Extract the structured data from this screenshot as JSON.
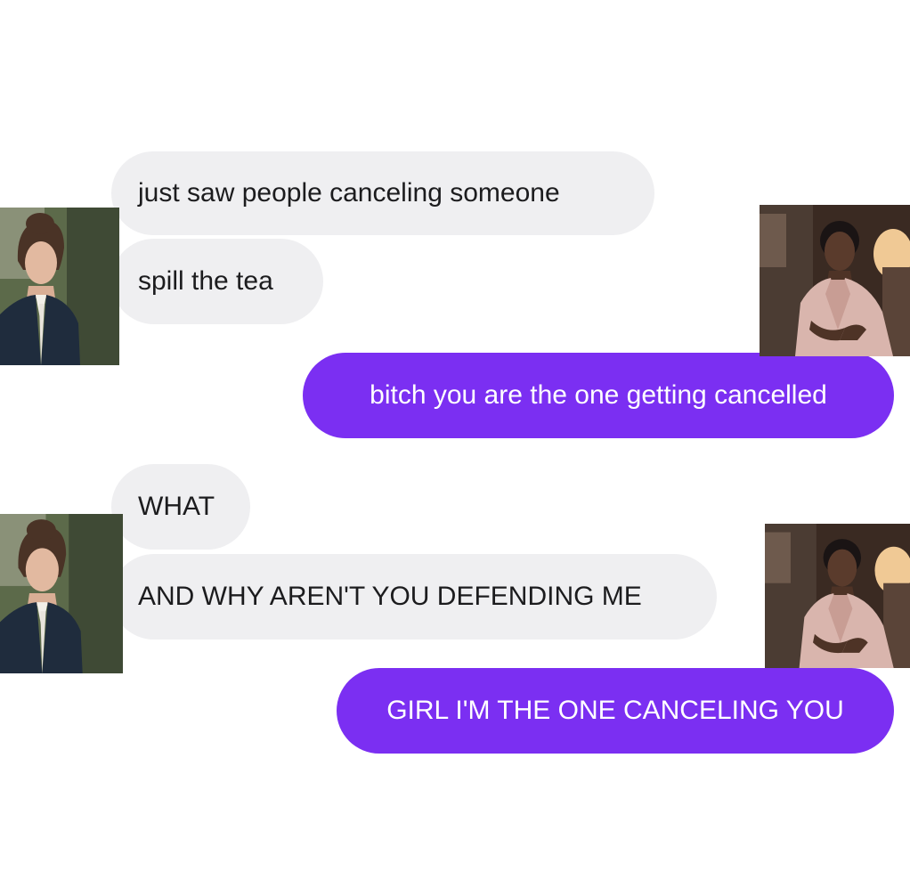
{
  "conversation": {
    "messages": [
      {
        "id": "m1",
        "side": "incoming",
        "text": "just saw people canceling someone"
      },
      {
        "id": "m2",
        "side": "incoming",
        "text": "spill the tea"
      },
      {
        "id": "m3",
        "side": "outgoing",
        "text": "bitch you are the one getting cancelled"
      },
      {
        "id": "m4",
        "side": "incoming",
        "text": "WHAT"
      },
      {
        "id": "m5",
        "side": "incoming",
        "text": "AND WHY AREN'T YOU DEFENDING ME"
      },
      {
        "id": "m6",
        "side": "outgoing",
        "text": "GIRL I'M THE ONE CANCELING YOU"
      }
    ],
    "colors": {
      "incoming_bubble": "#efeff1",
      "incoming_text": "#1c1c1e",
      "outgoing_bubble": "#7b2ff2",
      "outgoing_text": "#ffffff"
    },
    "avatars": [
      {
        "id": "a1",
        "side": "left",
        "icon": "woman-in-navy-blazer-portrait"
      },
      {
        "id": "a2",
        "side": "right",
        "icon": "woman-in-pink-coat-portrait"
      },
      {
        "id": "a3",
        "side": "left",
        "icon": "woman-in-navy-blazer-portrait"
      },
      {
        "id": "a4",
        "side": "right",
        "icon": "woman-in-pink-coat-portrait"
      }
    ]
  }
}
